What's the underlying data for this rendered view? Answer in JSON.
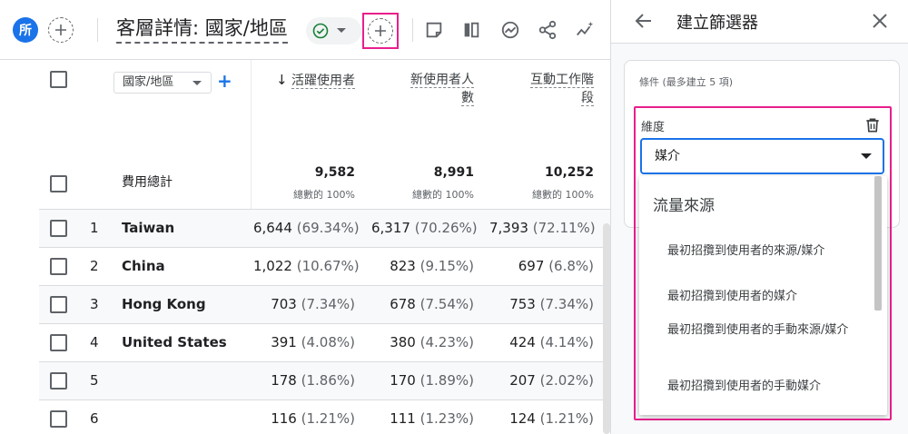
{
  "header": {
    "avatar": "所",
    "title": "客層詳情: 國家/地區"
  },
  "table": {
    "dimension_select": "國家/地區",
    "columns": [
      {
        "label": "活躍使用者",
        "sorted": true
      },
      {
        "label_line1": "新使用者人",
        "label_line2": "數"
      },
      {
        "label_line1": "互動工作階",
        "label_line2": "段"
      }
    ],
    "total_label": "費用總計",
    "totals": [
      {
        "value": "9,582",
        "sub": "總數的 100%"
      },
      {
        "value": "8,991",
        "sub": "總數的 100%"
      },
      {
        "value": "10,252",
        "sub": "總數的 100%"
      }
    ],
    "rows": [
      {
        "idx": "1",
        "name": "Taiwan",
        "c1": "6,644",
        "p1": "(69.34%)",
        "c2": "6,317",
        "p2": "(70.26%)",
        "c3": "7,393",
        "p3": "(72.11%)"
      },
      {
        "idx": "2",
        "name": "China",
        "c1": "1,022",
        "p1": "(10.67%)",
        "c2": "823",
        "p2": "(9.15%)",
        "c3": "697",
        "p3": "(6.8%)"
      },
      {
        "idx": "3",
        "name": "Hong Kong",
        "c1": "703",
        "p1": "(7.34%)",
        "c2": "678",
        "p2": "(7.54%)",
        "c3": "753",
        "p3": "(7.34%)"
      },
      {
        "idx": "4",
        "name": "United States",
        "c1": "391",
        "p1": "(4.08%)",
        "c2": "380",
        "p2": "(4.23%)",
        "c3": "424",
        "p3": "(4.14%)"
      },
      {
        "idx": "5",
        "name": "",
        "c1": "178",
        "p1": "(1.86%)",
        "c2": "170",
        "p2": "(1.89%)",
        "c3": "207",
        "p3": "(2.02%)"
      },
      {
        "idx": "6",
        "name": "",
        "c1": "116",
        "p1": "(1.21%)",
        "c2": "111",
        "p2": "(1.23%)",
        "c3": "124",
        "p3": "(1.21%)"
      }
    ]
  },
  "panel": {
    "title": "建立篩選器",
    "conditions_label": "條件 (最多建立 5 項)",
    "dimension_label": "維度",
    "dimension_value": "媒介",
    "menu_group": "流量來源",
    "menu_items": [
      "最初招攬到使用者的來源/媒介",
      "最初招攬到使用者的媒介",
      "最初招攬到使用者的手動來源/媒介",
      "最初招攬到使用者的手動媒介"
    ]
  },
  "colors": {
    "accent": "#1a73e8",
    "highlight": "#e91e8c",
    "status_ok": "#188038"
  }
}
